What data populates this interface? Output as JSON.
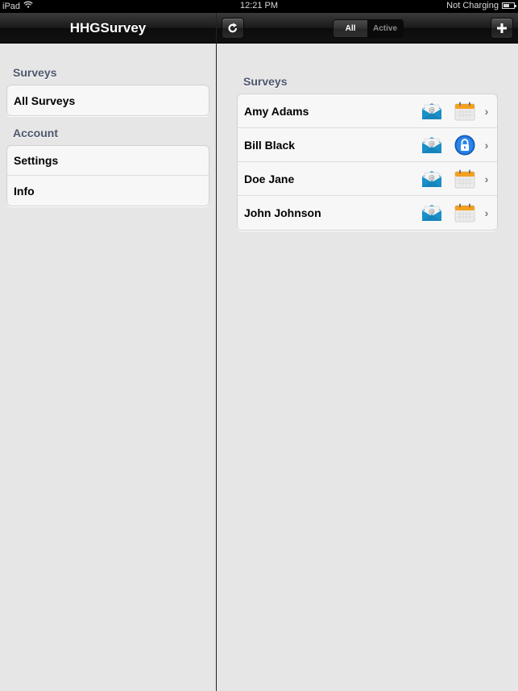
{
  "status_bar": {
    "device": "iPad",
    "time": "12:21 PM",
    "charging": "Not Charging"
  },
  "master": {
    "title": "HHGSurvey",
    "sections": [
      {
        "header": "Surveys",
        "items": [
          {
            "label": "All Surveys"
          }
        ]
      },
      {
        "header": "Account",
        "items": [
          {
            "label": "Settings"
          },
          {
            "label": "Info"
          }
        ]
      }
    ]
  },
  "detail": {
    "toolbar": {
      "refresh_icon": "refresh-icon",
      "add_icon": "plus-icon",
      "segments": [
        {
          "label": "All",
          "selected": true
        },
        {
          "label": "Active",
          "selected": false
        }
      ]
    },
    "section_header": "Surveys",
    "surveys": [
      {
        "name": "Amy Adams",
        "icons": [
          "mail-icon",
          "calendar-icon"
        ]
      },
      {
        "name": "Bill Black",
        "icons": [
          "mail-icon",
          "lock-icon"
        ]
      },
      {
        "name": "Doe Jane",
        "icons": [
          "mail-icon",
          "calendar-icon"
        ]
      },
      {
        "name": "John Johnson",
        "icons": [
          "mail-icon",
          "calendar-icon"
        ]
      }
    ]
  },
  "colors": {
    "section_header": "#4c566c",
    "mail_blue": "#1a8fc8",
    "calendar_orange": "#f5a01e",
    "lock_blue": "#1f6fd6"
  }
}
